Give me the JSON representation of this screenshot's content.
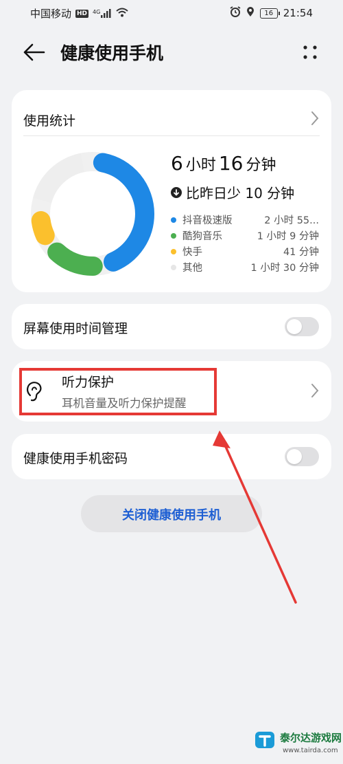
{
  "status_bar": {
    "carrier": "中国移动",
    "hd": "HD",
    "signal_type": "4G",
    "battery": "16",
    "time": "21:54"
  },
  "header": {
    "title": "健康使用手机",
    "icons": [
      "back-arrow-icon",
      "more-dots-icon"
    ]
  },
  "usage": {
    "heading": "使用统计",
    "total_hours": "6",
    "hour_unit": "小时",
    "total_minutes": "16",
    "minute_unit": "分钟",
    "delta_text": "比昨日少 10 分钟",
    "apps": [
      {
        "name": "抖音极速版",
        "time": "2 小时 55...",
        "color": "#1e88e5"
      },
      {
        "name": "酷狗音乐",
        "time": "1 小时 9 分钟",
        "color": "#4caf50"
      },
      {
        "name": "快手",
        "time": "41 分钟",
        "color": "#fbc02d"
      },
      {
        "name": "其他",
        "time": "1 小时 30 分钟",
        "color": "#e6e6e6"
      }
    ]
  },
  "chart_data": {
    "type": "pie",
    "categories": [
      "抖音极速版",
      "酷狗音乐",
      "快手",
      "其他"
    ],
    "values": [
      175,
      69,
      41,
      90
    ],
    "colors": [
      "#1e88e5",
      "#4caf50",
      "#fbc02d",
      "#eeeeee"
    ]
  },
  "settings": {
    "screen_time_label": "屏幕使用时间管理",
    "screen_time_enabled": false,
    "hearing_title": "听力保护",
    "hearing_subtitle": "耳机音量及听力保护提醒",
    "password_label": "健康使用手机密码",
    "password_enabled": false
  },
  "close_button": "关闭健康使用手机",
  "watermark": {
    "name": "泰尔达游戏网",
    "url": "www.tairda.com"
  },
  "colors": {
    "accent": "#1e5fd3",
    "highlight": "#e53935",
    "background": "#f1f2f4"
  }
}
